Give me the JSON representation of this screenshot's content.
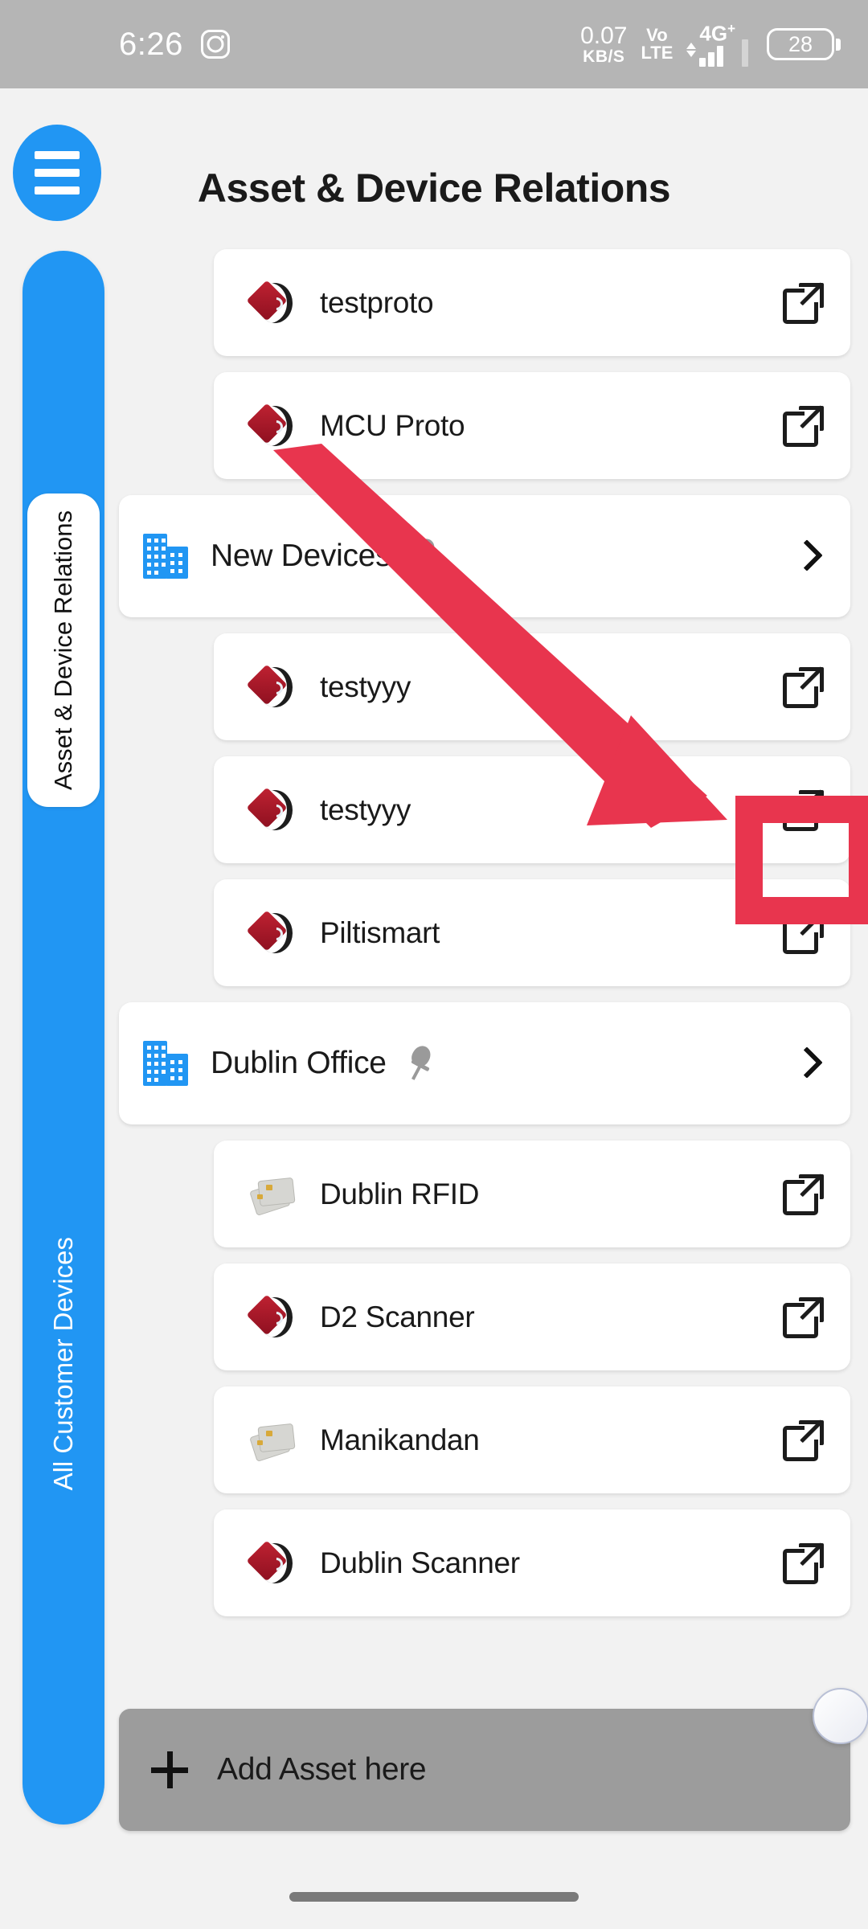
{
  "status_bar": {
    "time": "6:26",
    "instagram_icon": "instagram-icon",
    "network_speed_value": "0.07",
    "network_speed_unit": "KB/S",
    "volte_top": "Vo",
    "volte_bottom": "LTE",
    "network_type": "4G",
    "network_type_sup": "+",
    "battery_level": "28"
  },
  "header": {
    "menu_icon": "hamburger-menu-icon",
    "title": "Asset & Device Relations"
  },
  "sidebar": {
    "accent_color": "#2196f3",
    "tabs": [
      {
        "label": "Asset & Device Relations",
        "active": true
      },
      {
        "label": "All Customer Devices",
        "active": false
      }
    ]
  },
  "list": {
    "items": [
      {
        "type": "asset",
        "label": "testproto",
        "icon": "scanner-device-icon",
        "action_icon": "external-link-icon",
        "highlighted": false
      },
      {
        "type": "asset",
        "label": "MCU Proto",
        "icon": "scanner-device-icon",
        "action_icon": "external-link-icon",
        "highlighted": false
      },
      {
        "type": "group",
        "label": "New Devices",
        "icon": "building-icon",
        "pin_icon": "pin-icon",
        "action_icon": "chevron-right-icon"
      },
      {
        "type": "asset",
        "label": "testyyy",
        "icon": "scanner-device-icon",
        "action_icon": "external-link-icon",
        "highlighted": false
      },
      {
        "type": "asset",
        "label": "testyyy",
        "icon": "scanner-device-icon",
        "action_icon": "external-link-icon",
        "highlighted": true
      },
      {
        "type": "asset",
        "label": "Piltismart",
        "icon": "scanner-device-icon",
        "action_icon": "external-link-icon",
        "highlighted": false
      },
      {
        "type": "group",
        "label": "Dublin Office",
        "icon": "building-icon",
        "pin_icon": "pin-icon",
        "action_icon": "chevron-right-icon"
      },
      {
        "type": "asset",
        "label": "Dublin RFID",
        "icon": "rfid-card-icon",
        "action_icon": "external-link-icon",
        "highlighted": false
      },
      {
        "type": "asset",
        "label": "D2 Scanner",
        "icon": "scanner-device-icon",
        "action_icon": "external-link-icon",
        "highlighted": false
      },
      {
        "type": "asset",
        "label": "Manikandan",
        "icon": "rfid-card-icon",
        "action_icon": "external-link-icon",
        "highlighted": false
      },
      {
        "type": "asset",
        "label": "Dublin Scanner",
        "icon": "scanner-device-icon",
        "action_icon": "external-link-icon",
        "highlighted": false
      }
    ]
  },
  "add_asset": {
    "plus_icon": "plus-icon",
    "label": "Add Asset here"
  },
  "annotation": {
    "arrow_color": "#e8354e",
    "highlight_color": "#e8354e",
    "target": "external-link-icon"
  },
  "float_button": {
    "name": "floating-assistant-button"
  },
  "gesture_pill": {
    "name": "home-gesture-indicator"
  }
}
